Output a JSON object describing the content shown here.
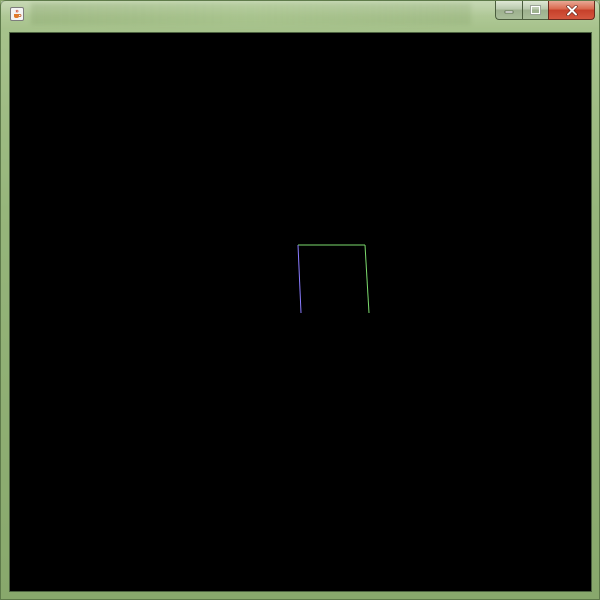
{
  "window": {
    "title": "",
    "buttons": [
      "minimize",
      "maximize",
      "close"
    ],
    "frame_color": "#96b57b",
    "canvas_background": "#000000"
  },
  "icons": {
    "app": "java-cup-icon",
    "minimize": "minimize-icon",
    "maximize": "maximize-icon",
    "close": "close-icon"
  },
  "colors": {
    "edge_top": "#7ddc6e",
    "edge_left": "#8a7cff",
    "edge_right": "#7ddc6e"
  }
}
